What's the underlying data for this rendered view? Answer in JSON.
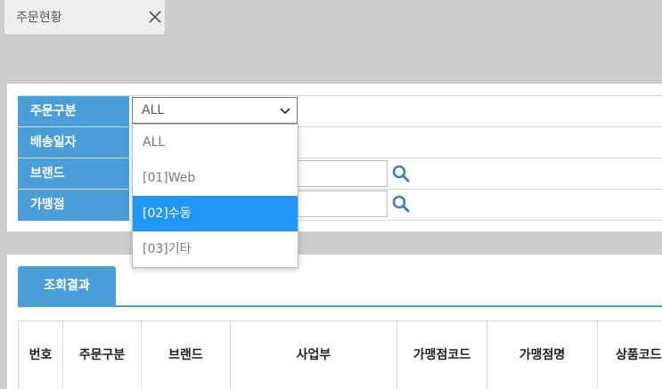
{
  "tab": {
    "label": "주문현황"
  },
  "search_form": {
    "rows": [
      {
        "label": "주문구분"
      },
      {
        "label": "배송일자"
      },
      {
        "label": "브랜드"
      },
      {
        "label": "가맹점"
      }
    ],
    "order_type_select": {
      "value": "ALL",
      "options": [
        "ALL",
        "[01]Web",
        "[02]수동",
        "[03]기타"
      ],
      "highlighted": "[02]수동"
    }
  },
  "results": {
    "tab_label": "조회결과",
    "columns": [
      "번호",
      "주문구분",
      "브랜드",
      "사업부",
      "가맹점코드",
      "가맹점명",
      "상품코드"
    ]
  },
  "colors": {
    "accent": "#4a9fd8",
    "highlight": "#2196f3",
    "background": "#cdcdcd"
  },
  "icons": {
    "close": "close-icon",
    "search": "search-icon",
    "dropdown": "chevron-down-icon"
  }
}
